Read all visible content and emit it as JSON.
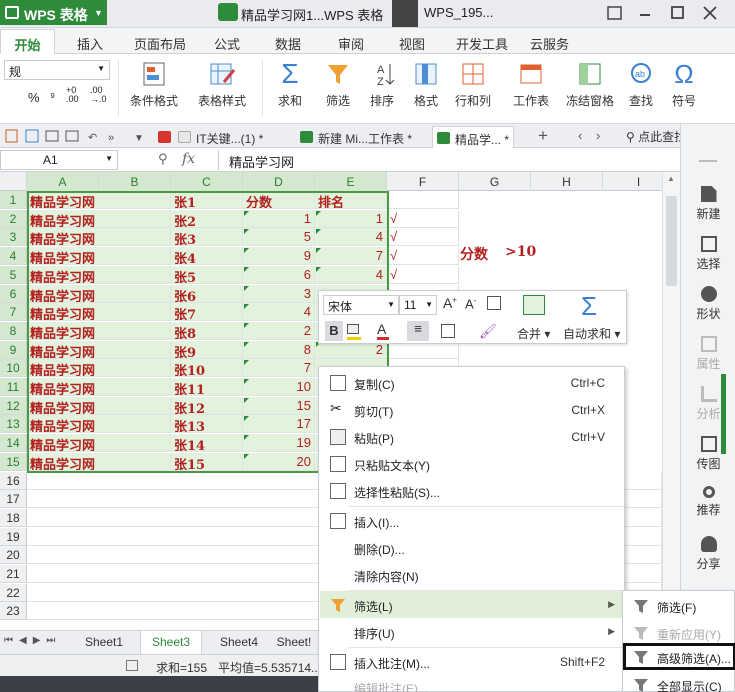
{
  "app": {
    "name": "WPS 表格",
    "title": "精品学习网1...WPS 表格",
    "user": "WPS_195..."
  },
  "ribbon_tabs": [
    "开始",
    "插入",
    "页面布局",
    "公式",
    "数据",
    "审阅",
    "视图",
    "开发工具",
    "云服务"
  ],
  "ribbon": {
    "number_format": "规",
    "percent": "%",
    "buttons": [
      "条件格式",
      "表格样式",
      "求和",
      "筛选",
      "排序",
      "格式",
      "行和列",
      "工作表",
      "冻结窗格",
      "查找",
      "符号"
    ]
  },
  "doc_tabs": [
    "IT关键...(1) *",
    "新建 Mi...工作表 *",
    "精品学... *"
  ],
  "doc_tab_search": "点此查找命令",
  "formula_bar": {
    "cell": "A1",
    "fx": "fx",
    "content": "精品学习网"
  },
  "columns": [
    "A",
    "B",
    "C",
    "D",
    "E",
    "F",
    "G",
    "H",
    "I"
  ],
  "row_numbers": [
    "1",
    "2",
    "3",
    "4",
    "5",
    "6",
    "7",
    "8",
    "9",
    "10",
    "11",
    "12",
    "13",
    "14",
    "15",
    "16",
    "17",
    "18",
    "19",
    "20",
    "21",
    "22",
    "23"
  ],
  "rows": [
    {
      "a": "精品学习网",
      "c": "张1",
      "d": "分数",
      "e": "排名"
    },
    {
      "a": "精品学习网",
      "c": "张2",
      "d": "1",
      "e": "1",
      "f": "√"
    },
    {
      "a": "精品学习网",
      "c": "张3",
      "d": "5",
      "e": "4",
      "f": "√"
    },
    {
      "a": "精品学习网",
      "c": "张4",
      "d": "9",
      "e": "7",
      "f": "√"
    },
    {
      "a": "精品学习网",
      "c": "张5",
      "d": "6",
      "e": "4",
      "f": "√"
    },
    {
      "a": "精品学习网",
      "c": "张6",
      "d": "3",
      "e": ""
    },
    {
      "a": "精品学习网",
      "c": "张7",
      "d": "4",
      "e": ""
    },
    {
      "a": "精品学习网",
      "c": "张8",
      "d": "2",
      "e": ""
    },
    {
      "a": "精品学习网",
      "c": "张9",
      "d": "8",
      "e": "2"
    },
    {
      "a": "精品学习网",
      "c": "张10",
      "d": "7",
      "e": ""
    },
    {
      "a": "精品学习网",
      "c": "张11",
      "d": "10",
      "e": ""
    },
    {
      "a": "精品学习网",
      "c": "张12",
      "d": "15",
      "e": ""
    },
    {
      "a": "精品学习网",
      "c": "张13",
      "d": "17",
      "e": ""
    },
    {
      "a": "精品学习网",
      "c": "张14",
      "d": "19",
      "e": ""
    },
    {
      "a": "精品学习网",
      "c": "张15",
      "d": "20",
      "e": ""
    }
  ],
  "criteria": {
    "label": "分数",
    "value": ">10"
  },
  "sheet_tabs": [
    "Sheet1",
    "Sheet3",
    "Sheet4",
    "Sheet!"
  ],
  "active_sheet": "Sheet3",
  "status": {
    "sum": "求和=155",
    "avg": "平均值=5.535714..."
  },
  "right_panel": [
    "新建",
    "选择",
    "形状",
    "属性",
    "分析",
    "传图",
    "推荐",
    "分享"
  ],
  "mini_toolbar": {
    "font": "宋体",
    "size": "11",
    "merge": "合并",
    "autosum": "自动求和"
  },
  "context_menu": [
    {
      "label": "复制(C)",
      "shortcut": "Ctrl+C"
    },
    {
      "label": "剪切(T)",
      "shortcut": "Ctrl+X"
    },
    {
      "label": "粘贴(P)",
      "shortcut": "Ctrl+V"
    },
    {
      "label": "只粘贴文本(Y)",
      "shortcut": ""
    },
    {
      "label": "选择性粘贴(S)...",
      "shortcut": ""
    },
    {
      "label": "插入(I)...",
      "shortcut": ""
    },
    {
      "label": "删除(D)...",
      "shortcut": ""
    },
    {
      "label": "清除内容(N)",
      "shortcut": ""
    },
    {
      "label": "筛选(L)",
      "shortcut": ""
    },
    {
      "label": "排序(U)",
      "shortcut": ""
    },
    {
      "label": "插入批注(M)...",
      "shortcut": "Shift+F2"
    },
    {
      "label": "编辑批注(E)...",
      "shortcut": ""
    }
  ],
  "submenu": [
    "筛选(F)",
    "重新应用(Y)",
    "高级筛选(A)...",
    "全部显示(C)"
  ],
  "colors": {
    "accent": "#2e8b3a",
    "cell_text": "#b22020",
    "highlight": "#e3f2dd"
  }
}
